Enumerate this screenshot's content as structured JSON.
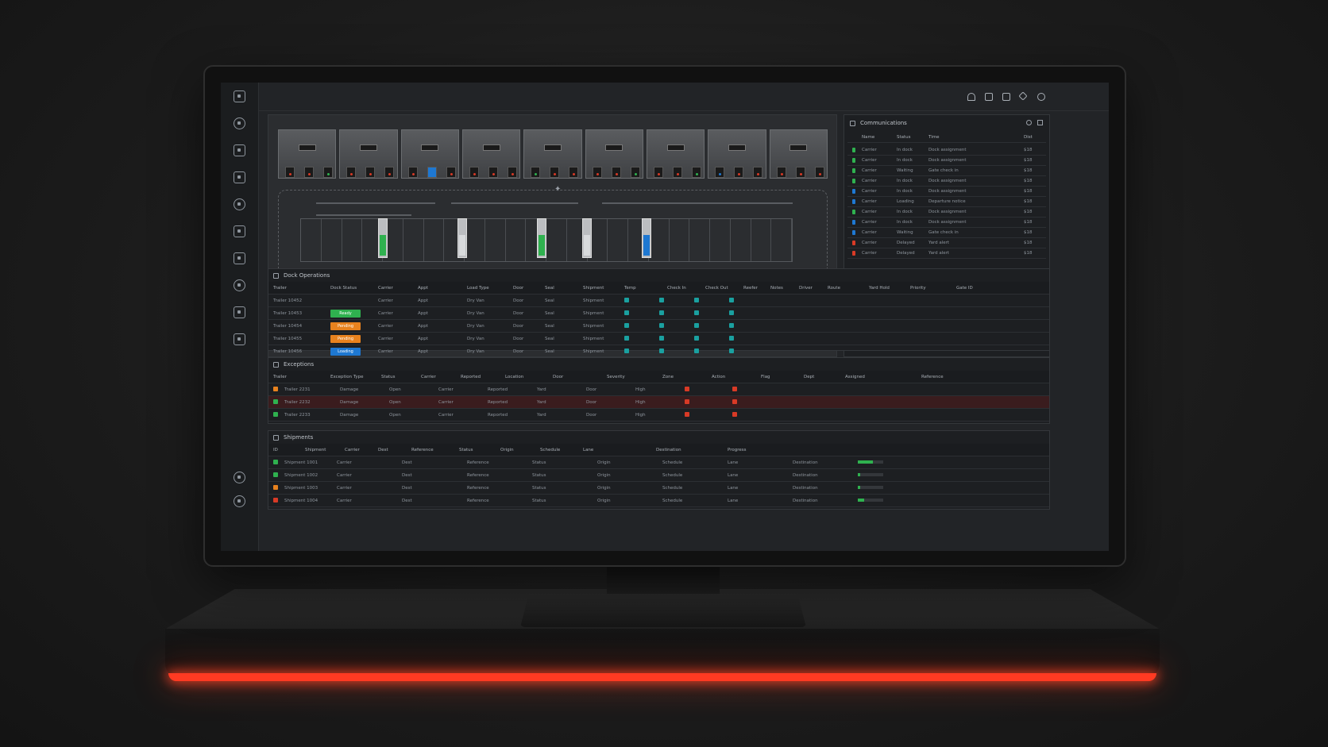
{
  "colors": {
    "green": "#2fb14f",
    "blue": "#1e78d2",
    "orange": "#e8821e",
    "red": "#d83a26",
    "teal": "#1aa0a0",
    "glow": "#ff3a22"
  },
  "sidebar": {
    "icons": [
      "grid-icon",
      "dashboard-icon",
      "scan-icon",
      "network-icon",
      "location-icon",
      "gallery-icon",
      "settings-icon",
      "map-pin-icon",
      "document-icon",
      "screen-icon"
    ],
    "bottom_icons": [
      "lock-icon",
      "user-icon"
    ]
  },
  "topbar": {
    "icons": [
      "bell-icon",
      "window-icon",
      "camera-icon",
      "diamond-icon",
      "circle-icon"
    ]
  },
  "map": {
    "bays": 9,
    "slots": 24
  },
  "feed": {
    "title": "Communications",
    "columns": [
      "Name",
      "Status",
      "Time",
      "Dist"
    ],
    "rows": [
      {
        "color": "green",
        "name": "Carrier",
        "status": "In dock",
        "desc": "Dock assignment",
        "val": "$18"
      },
      {
        "color": "green",
        "name": "Carrier",
        "status": "In dock",
        "desc": "Dock assignment",
        "val": "$18"
      },
      {
        "color": "green",
        "name": "Carrier",
        "status": "Waiting",
        "desc": "Gate check in",
        "val": "$18"
      },
      {
        "color": "green",
        "name": "Carrier",
        "status": "In dock",
        "desc": "Dock assignment",
        "val": "$18"
      },
      {
        "color": "blue",
        "name": "Carrier",
        "status": "In dock",
        "desc": "Dock assignment",
        "val": "$18"
      },
      {
        "color": "blue",
        "name": "Carrier",
        "status": "Loading",
        "desc": "Departure notice",
        "val": "$18"
      },
      {
        "color": "green",
        "name": "Carrier",
        "status": "In dock",
        "desc": "Dock assignment",
        "val": "$18"
      },
      {
        "color": "blue",
        "name": "Carrier",
        "status": "In dock",
        "desc": "Dock assignment",
        "val": "$18"
      },
      {
        "color": "blue",
        "name": "Carrier",
        "status": "Waiting",
        "desc": "Gate check in",
        "val": "$18"
      },
      {
        "color": "red",
        "name": "Carrier",
        "status": "Delayed",
        "desc": "Yard alert",
        "val": "$18"
      },
      {
        "color": "red",
        "name": "Carrier",
        "status": "Delayed",
        "desc": "Yard alert",
        "val": "$18"
      }
    ]
  },
  "table1": {
    "title": "Dock Operations",
    "columns": [
      "Trailer",
      "Dock Status",
      "Carrier",
      "Appt",
      "Load Type",
      "Door",
      "Seal",
      "Shipment",
      "Temp",
      "Check In",
      "Check Out",
      "Reefer",
      "Notes",
      "Driver",
      "Route",
      "Yard Hold",
      "Priority",
      "Gate ID"
    ],
    "rows": [
      {
        "id": "Trailer 10452",
        "pill": "",
        "pillColor": ""
      },
      {
        "id": "Trailer 10453",
        "pill": "Ready",
        "pillColor": "green"
      },
      {
        "id": "Trailer 10454",
        "pill": "Pending",
        "pillColor": "orange"
      },
      {
        "id": "Trailer 10455",
        "pill": "Pending",
        "pillColor": "orange"
      },
      {
        "id": "Trailer 10456",
        "pill": "Loading",
        "pillColor": "blue"
      }
    ]
  },
  "table2": {
    "title": "Exceptions",
    "columns": [
      "Trailer",
      "Exception Type",
      "Status",
      "Carrier",
      "Reported",
      "Location",
      "Door",
      "Severity",
      "Zone",
      "Action",
      "Flag",
      "Dept",
      "Assigned",
      "Reference"
    ],
    "rows": [
      {
        "color": "orange",
        "id": "Trailer 2231",
        "alert": false
      },
      {
        "color": "green",
        "id": "Trailer 2232",
        "alert": true
      },
      {
        "color": "green",
        "id": "Trailer 2233",
        "alert": false
      }
    ]
  },
  "table3": {
    "title": "Shipments",
    "columns": [
      "ID",
      "Shipment",
      "Carrier",
      "Dest",
      "Reference",
      "Status",
      "Origin",
      "Schedule",
      "Lane",
      "Destination",
      "Progress"
    ],
    "rows": [
      {
        "color": "green",
        "id": "Shipment 1001",
        "progress": 0.6
      },
      {
        "color": "green",
        "id": "Shipment 1002",
        "progress": 0.1
      },
      {
        "color": "orange",
        "id": "Shipment 1003",
        "progress": 0.08
      },
      {
        "color": "red",
        "id": "Shipment 1004",
        "progress": 0.25
      }
    ]
  }
}
